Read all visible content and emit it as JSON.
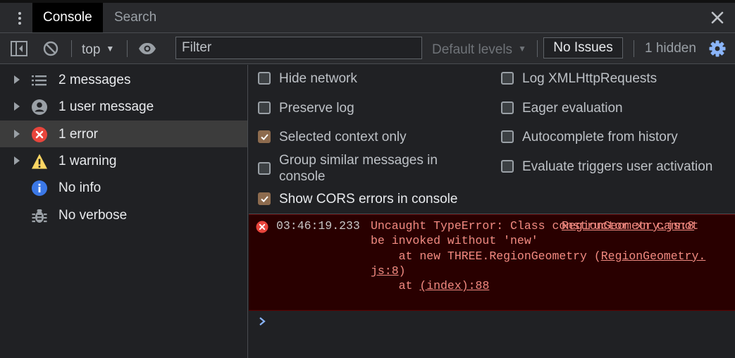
{
  "tabs": {
    "console": "Console",
    "search": "Search"
  },
  "toolbar": {
    "context": "top",
    "filter_placeholder": "Filter",
    "levels": "Default levels",
    "issues": "No Issues",
    "hidden_count": "1 hidden"
  },
  "sidebar": {
    "items": [
      {
        "label": "2 messages",
        "icon": "list-icon",
        "expandable": true
      },
      {
        "label": "1 user message",
        "icon": "user-icon",
        "expandable": true
      },
      {
        "label": "1 error",
        "icon": "error-icon",
        "expandable": true,
        "selected": true
      },
      {
        "label": "1 warning",
        "icon": "warning-icon",
        "expandable": true
      },
      {
        "label": "No info",
        "icon": "info-icon",
        "expandable": false
      },
      {
        "label": "No verbose",
        "icon": "bug-icon",
        "expandable": false
      }
    ]
  },
  "settings": {
    "hide_network": {
      "label": "Hide network",
      "checked": false
    },
    "preserve_log": {
      "label": "Preserve log",
      "checked": false
    },
    "selected_context": {
      "label": "Selected context only",
      "checked": true
    },
    "group_similar": {
      "label": "Group similar messages in console",
      "checked": false
    },
    "show_cors": {
      "label": "Show CORS errors in console",
      "checked": true
    },
    "log_xhr": {
      "label": "Log XMLHttpRequests",
      "checked": false
    },
    "eager_eval": {
      "label": "Eager evaluation",
      "checked": false
    },
    "autocomplete": {
      "label": "Autocomplete from history",
      "checked": false
    },
    "evaluate_triggers": {
      "label": "Evaluate triggers user activation",
      "checked": false
    }
  },
  "error": {
    "timestamp": "03:46:19.233",
    "source": "RegionGeometry.js:8",
    "message": "Uncaught TypeError: Class constructor xn cannot be invoked without 'new'",
    "stack1_prefix": "    at new THREE.RegionGeometry (",
    "stack1_link": "RegionGeometry.js:8",
    "stack1_suffix": ")",
    "stack2_prefix": "    at ",
    "stack2_link": "(index):88"
  },
  "colors": {
    "error_text": "#f28b82",
    "error_bg": "#290000",
    "accent_blue": "#8ab4f8",
    "checkbox_checked": "#8d6b4e",
    "warning_yellow": "#fdd663",
    "error_red": "#e8453c"
  }
}
